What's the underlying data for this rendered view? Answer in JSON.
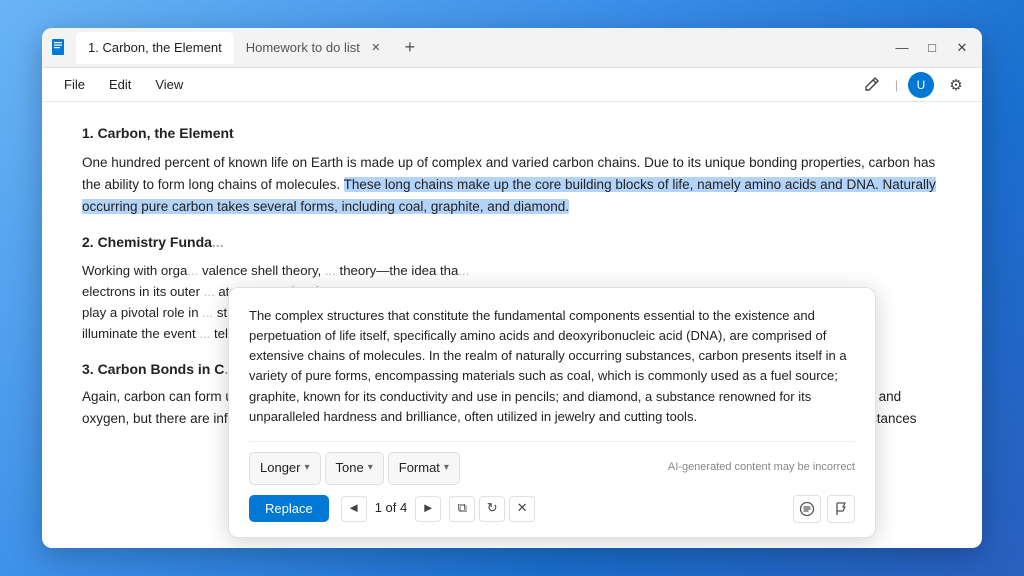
{
  "window": {
    "title": "1. Carbon, the Element",
    "tab1": "1. Carbon, the Element",
    "tab2": "Homework to do list",
    "icon_text": "📄"
  },
  "menu": {
    "file": "File",
    "edit": "Edit",
    "view": "View"
  },
  "document": {
    "heading1": "1. Carbon, the Element",
    "para1_before": "One hundred percent of known life on Earth is made up of complex and varied carbon chains. Due to its unique bonding properties, carbon has the ability to form long chains of molecules.",
    "para1_highlight": "These long chains make up the core building blocks of life, namely amino acids and DNA. Naturally occurring pure carbon takes several forms, including coal, graphite, and diamond.",
    "heading2": "2. Chemistry Funda",
    "para2_start": "Working with orga",
    "para2_mid": "valence shell theory,",
    "para2_continue": "theory—the idea tha",
    "para2_line2": "electrons in its outer",
    "para2_line3": "atoms or molecules.",
    "para2_line4": "play a pivotal role in",
    "para2_line5": "structures) can help",
    "para2_line6": "illuminate the event",
    "para2_line7": "tell us its basic shap",
    "heading3": "3. Carbon Bonds in C",
    "para3": "Again, carbon can form up to four bonds with other molecules. In organic chemistry, we mainly focus on carbon chains with hydrogen and oxygen, but there are infinite possible compounds. In the simplest form, carbon bonds with four hydrogen in single bonds. In other instances"
  },
  "ai_popup": {
    "text": "The complex structures that constitute the fundamental components essential to the existence and perpetuation of life itself, specifically amino acids and deoxyribonucleic acid (DNA), are comprised of extensive chains of molecules. In the realm of naturally occurring substances, carbon presents itself in a variety of pure forms, encompassing materials such as coal, which is commonly used as a fuel source; graphite, known for its conductivity and use in pencils; and diamond, a substance renowned for its unparalleled hardness and brilliance, often utilized in jewelry and cutting tools.",
    "dropdown1": "Longer",
    "dropdown2": "Tone",
    "dropdown3": "Format",
    "disclaimer": "AI-generated content may be incorrect",
    "replace_btn": "Replace",
    "nav_prev": "◄",
    "nav_label": "1 of 4",
    "nav_next": "►"
  },
  "colors": {
    "highlight_bg": "#b3d4f8",
    "replace_btn": "#0078d4",
    "accent": "#0078d4"
  },
  "icons": {
    "minimize": "—",
    "maximize": "□",
    "close": "✕",
    "add_tab": "+",
    "pencil": "✏",
    "gear": "⚙",
    "copy": "⧉",
    "refresh": "↻",
    "dismiss": "✕",
    "stack": "≡",
    "flag": "⚑"
  }
}
